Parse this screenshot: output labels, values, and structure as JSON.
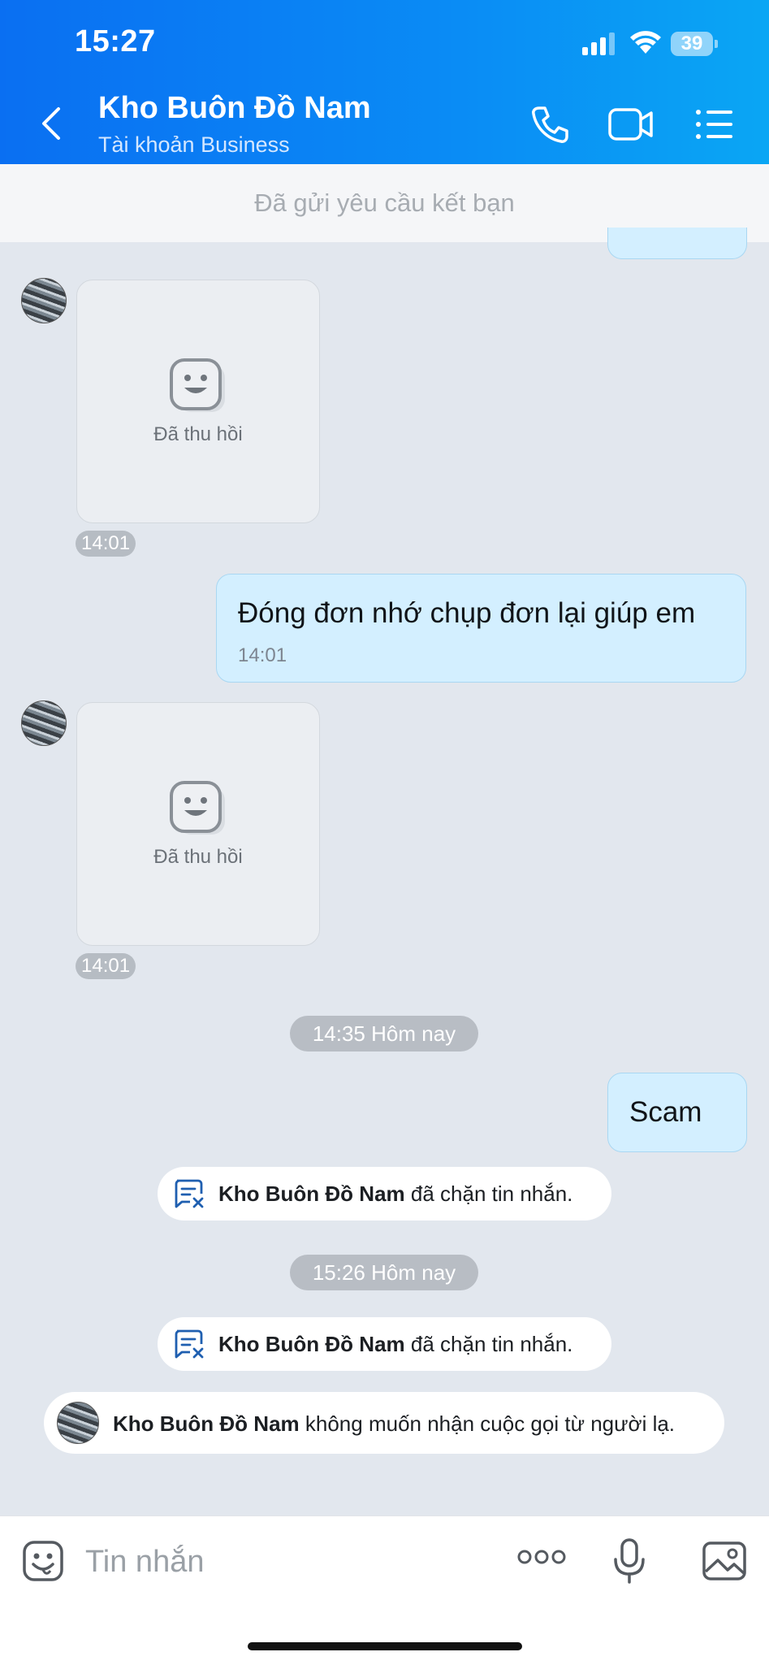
{
  "status_bar": {
    "time": "15:27",
    "battery": "39"
  },
  "header": {
    "contact_name": "Kho Buôn Đồ Nam",
    "account_type": "Tài khoản Business",
    "icons": [
      "back-arrow-icon",
      "phone-icon",
      "video-camera-icon",
      "menu-list-icon"
    ]
  },
  "friend_banner": "Đã gửi yêu cầu kết bạn",
  "messages": [
    {
      "type": "recalled",
      "label": "Đã thu hồi",
      "time": "14:01"
    },
    {
      "type": "outgoing",
      "text": "Đóng đơn nhớ chụp đơn lại giúp em",
      "time": "14:01"
    },
    {
      "type": "recalled",
      "label": "Đã thu hồi",
      "time": "14:01"
    },
    {
      "type": "divider",
      "text": "14:35 Hôm nay"
    },
    {
      "type": "outgoing",
      "text": "Scam"
    },
    {
      "type": "system",
      "name": "Kho Buôn Đồ Nam",
      "text": "đã chặn tin nhắn."
    },
    {
      "type": "divider",
      "text": "15:26 Hôm nay"
    },
    {
      "type": "system",
      "name": "Kho Buôn Đồ Nam",
      "text": "đã chặn tin nhắn."
    },
    {
      "type": "system-call",
      "name": "Kho Buôn Đồ Nam",
      "text": "không muốn nhận cuộc gọi từ người lạ."
    }
  ],
  "input_bar": {
    "placeholder": "Tin nhắn",
    "icons": [
      "emoji-sticker-icon",
      "more-options-icon",
      "microphone-icon",
      "image-gallery-icon"
    ]
  },
  "colors": {
    "header_start": "#0a6ff2",
    "header_end": "#0aa6f4",
    "outgoing_bubble": "#d3efff",
    "chat_bg": "#e2e7ee"
  }
}
